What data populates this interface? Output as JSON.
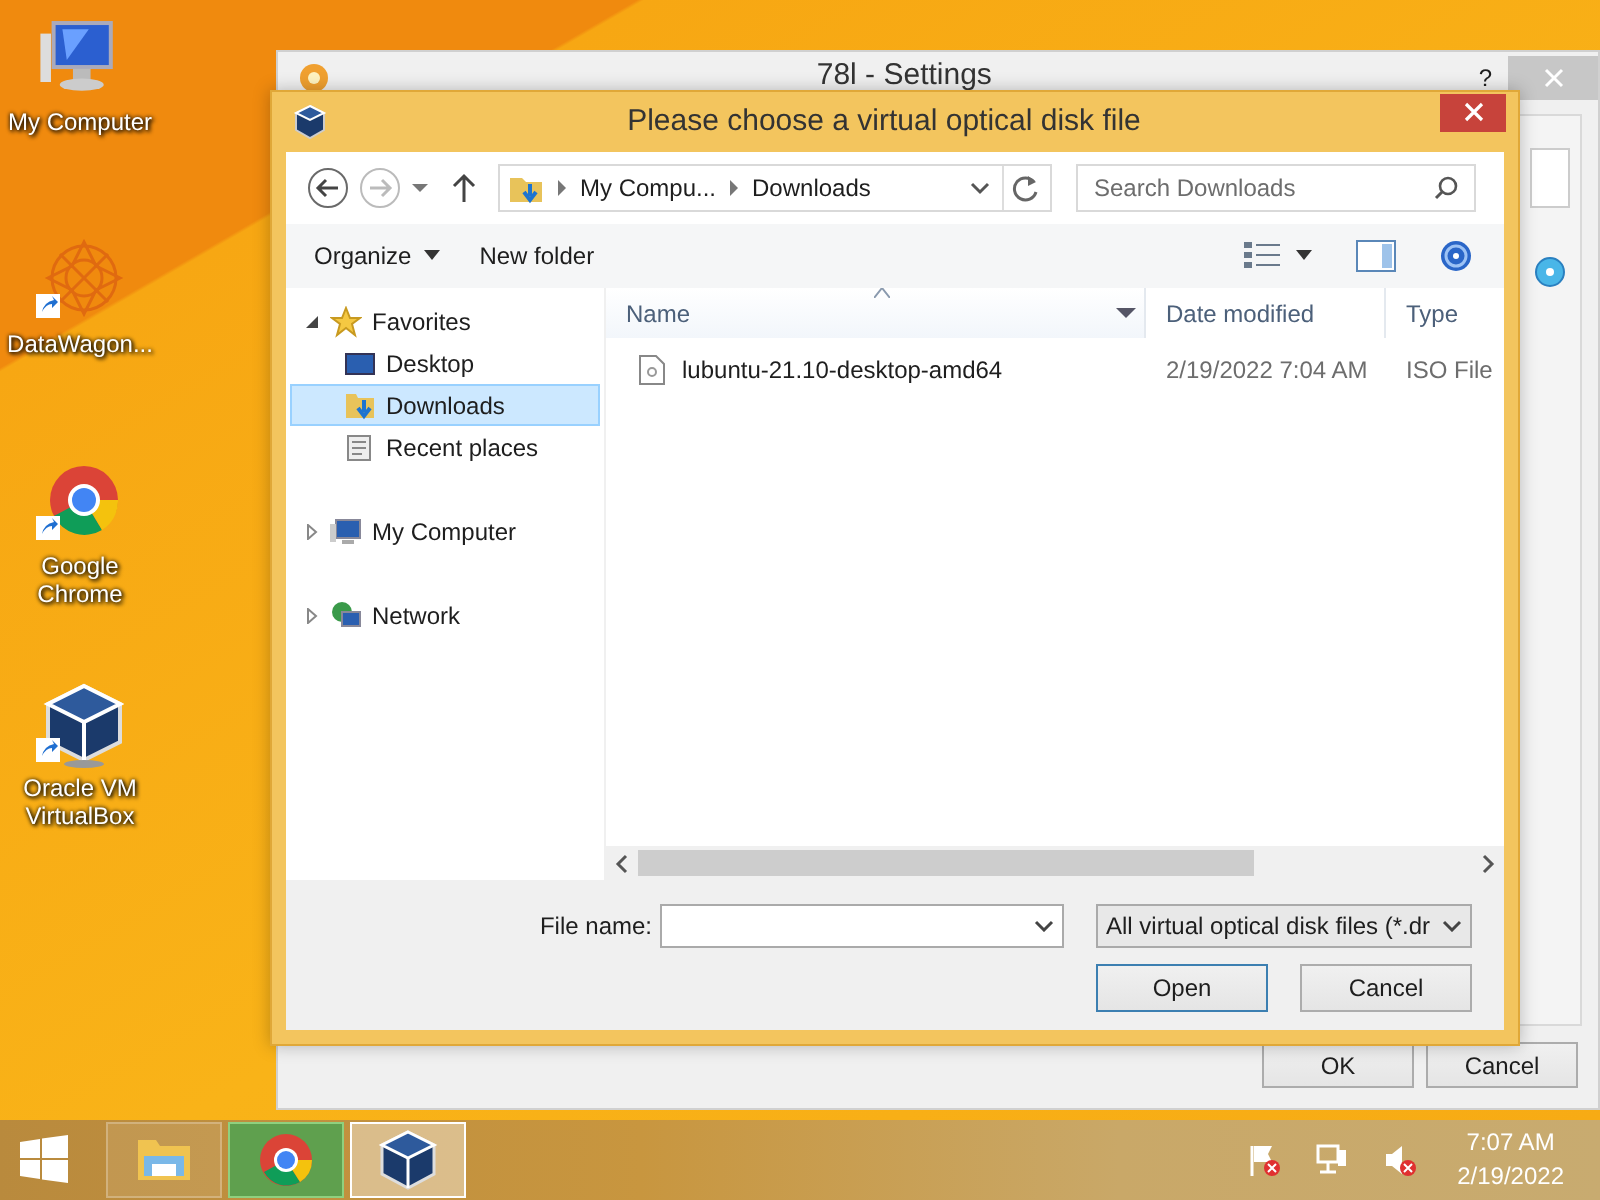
{
  "desktop_icons": [
    {
      "label": "My Computer",
      "kind": "computer"
    },
    {
      "label": "DataWagon...",
      "kind": "datawagon"
    },
    {
      "label": "Google Chrome",
      "kind": "chrome"
    },
    {
      "label": "Oracle VM VirtualBox",
      "kind": "virtualbox"
    }
  ],
  "settings_window": {
    "title": "78l - Settings",
    "help": "?",
    "buttons": [
      "OK",
      "Cancel"
    ]
  },
  "dialog": {
    "title": "Please choose a virtual optical disk file",
    "breadcrumb": [
      "My Compu...",
      "Downloads"
    ],
    "search": {
      "placeholder": "Search Downloads"
    },
    "toolbar": [
      "Organize",
      "New folder"
    ],
    "nav": [
      {
        "label": "Favorites",
        "kind": "favorites",
        "expanded": true,
        "selected": false,
        "children": [
          {
            "label": "Desktop",
            "kind": "desktop",
            "selected": false
          },
          {
            "label": "Downloads",
            "kind": "downloads",
            "selected": true
          },
          {
            "label": "Recent places",
            "kind": "recent",
            "selected": false
          }
        ]
      },
      {
        "label": "My Computer",
        "kind": "computer",
        "expanded": false,
        "selected": false
      },
      {
        "label": "Network",
        "kind": "network",
        "expanded": false,
        "selected": false
      }
    ],
    "columns": [
      "Name",
      "Date modified",
      "Type"
    ],
    "files": [
      {
        "name": "lubuntu-21.10-desktop-amd64",
        "date": "2/19/2022 7:04 AM",
        "type": "ISO File"
      }
    ],
    "file_name_label": "File name:",
    "filter": "All virtual optical disk files (*.dr",
    "buttons": [
      "Open",
      "Cancel"
    ]
  },
  "taskbar": {
    "apps": [
      {
        "kind": "explorer",
        "running": false,
        "selected": false
      },
      {
        "kind": "chrome",
        "running": true,
        "selected": false
      },
      {
        "kind": "virtualbox",
        "running": true,
        "selected": true
      }
    ],
    "time": "7:07 AM",
    "date": "2/19/2022"
  }
}
